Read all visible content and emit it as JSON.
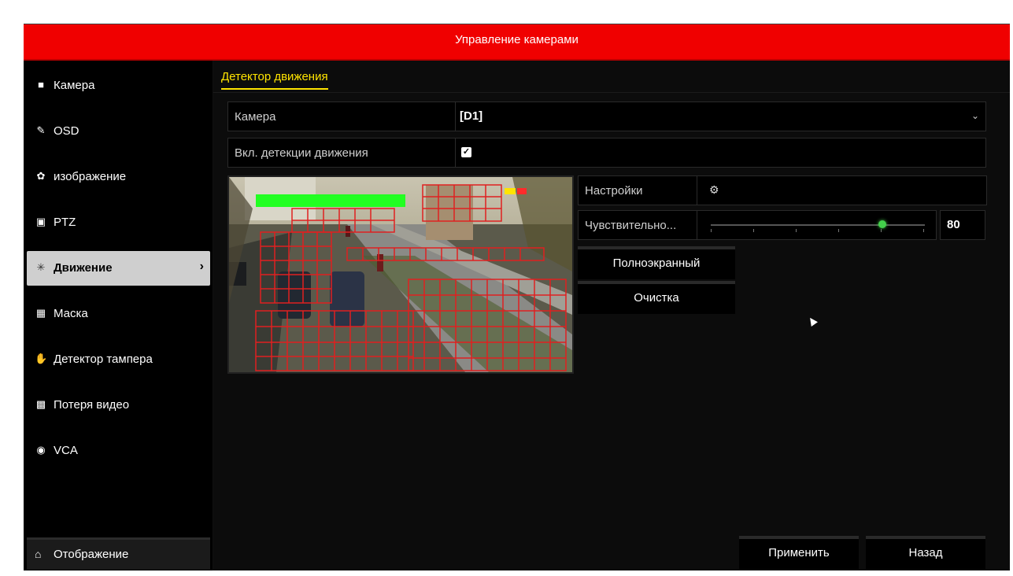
{
  "header": {
    "title": "Управление камерами"
  },
  "sidebar": {
    "items": [
      {
        "label": "Камера",
        "icon": "camera-icon"
      },
      {
        "label": "OSD",
        "icon": "pen-icon"
      },
      {
        "label": "изображение",
        "icon": "palette-icon"
      },
      {
        "label": "PTZ",
        "icon": "ptz-icon"
      },
      {
        "label": "Движение",
        "icon": "motion-icon",
        "active": true
      },
      {
        "label": "Маска",
        "icon": "mask-icon"
      },
      {
        "label": "Детектор тампера",
        "icon": "hand-icon"
      },
      {
        "label": "Потеря видео",
        "icon": "video-loss-icon"
      },
      {
        "label": "VCA",
        "icon": "vca-icon"
      }
    ],
    "bottom": {
      "label": "Отображение",
      "icon": "home-icon"
    }
  },
  "main": {
    "tab": "Детектор движения",
    "camera": {
      "label": "Камера",
      "value": "[D1]"
    },
    "enable": {
      "label": "Вкл. детекции движения",
      "checked": true
    },
    "settings": {
      "label": "Настройки"
    },
    "sensitivity": {
      "label": "Чувствительно...",
      "value": "80",
      "level_percent": 80
    },
    "fullscreen_button": "Полноэкранный",
    "clear_button": "Очистка",
    "apply_button": "Применить",
    "back_button": "Назад"
  },
  "colors": {
    "titlebar": "#f00000",
    "accent": "#ffe400",
    "grid": "#e02020",
    "knob": "#43d14b"
  }
}
